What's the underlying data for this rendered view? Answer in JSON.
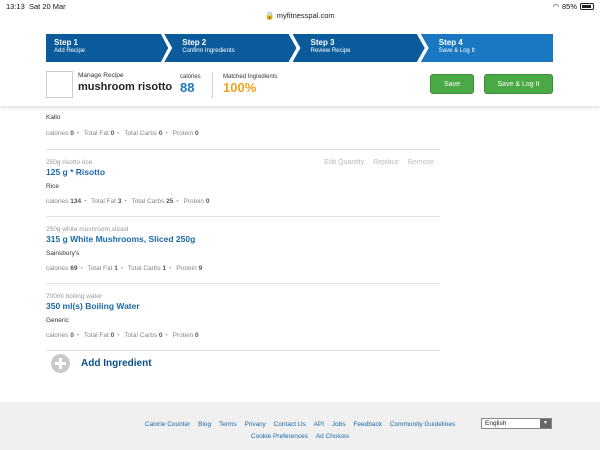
{
  "status": {
    "time": "13:13",
    "date": "Sat 20 Mar",
    "url": "myfitnesspal.com",
    "battery": "85%",
    "battery_level": 0.85
  },
  "steps": [
    {
      "num": "Step 1",
      "label": "Add Recipe"
    },
    {
      "num": "Step 2",
      "label": "Confirm Ingredients"
    },
    {
      "num": "Step 3",
      "label": "Review Recipe"
    },
    {
      "num": "Step 4",
      "label": "Save & Log It"
    }
  ],
  "header": {
    "manage_label": "Manage Recipe",
    "recipe_name": "mushroom risotto",
    "calories_label": "calories",
    "calories_value": "88",
    "matched_label": "Matched Ingredients",
    "matched_value": "100%",
    "save_label": "Save",
    "save_log_label": "Save & Log It"
  },
  "macro_labels": {
    "calories": "calories",
    "fat": "Total Fat",
    "carbs": "Total Carbs",
    "protein": "Protein"
  },
  "actions": {
    "edit": "Edit Quantity",
    "replace": "Replace",
    "remove": "Remove"
  },
  "partial_item": {
    "brand": "Kallo",
    "calories": "0",
    "fat": "0",
    "carbs": "0",
    "protein": "0"
  },
  "ingredients": [
    {
      "original": "250g risotto rice",
      "title": "125 g * Risotto",
      "brand": "Rice",
      "calories": "134",
      "fat": "3",
      "carbs": "25",
      "protein": "0"
    },
    {
      "original": "250g white mushroom,sliced",
      "title": "315 g White Mushrooms, Sliced 250g",
      "brand": "Sainsbury's",
      "calories": "69",
      "fat": "1",
      "carbs": "1",
      "protein": "9"
    },
    {
      "original": "700ml boiling water",
      "title": "350 ml(s) Boiling Water",
      "brand": "Generic",
      "calories": "0",
      "fat": "0",
      "carbs": "0",
      "protein": "0"
    }
  ],
  "add_ingredient": "Add Ingredient",
  "footer": {
    "links": [
      "Calorie Counter",
      "Blog",
      "Terms",
      "Privacy",
      "Contact Us",
      "API",
      "Jobs",
      "Feedback",
      "Community Guidelines",
      "Cookie Preferences",
      "Ad Choices"
    ],
    "language": "English"
  },
  "colors": {
    "step_dark": "#0b5b9c",
    "step_active": "#1a78c2",
    "accent_blue": "#1a78c2",
    "accent_orange": "#f0a21a",
    "button_green": "#4aa845"
  }
}
